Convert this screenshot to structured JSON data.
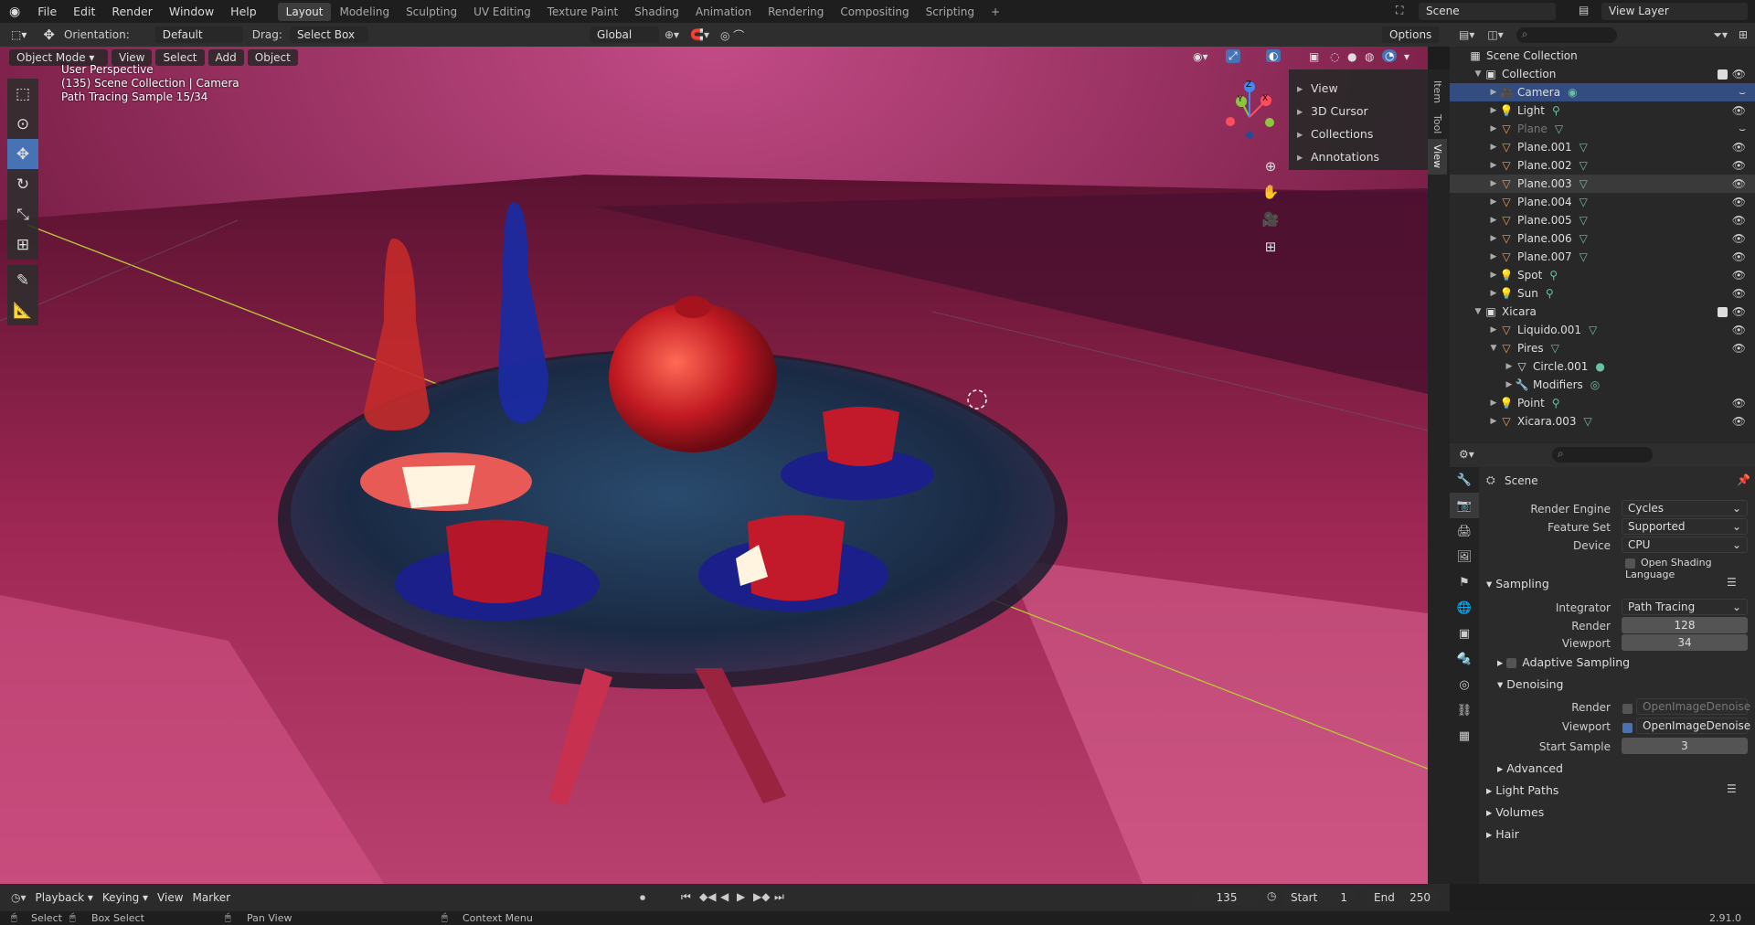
{
  "topbar": {
    "menus": [
      "File",
      "Edit",
      "Render",
      "Window",
      "Help"
    ],
    "workspaces": [
      "Layout",
      "Modeling",
      "Sculpting",
      "UV Editing",
      "Texture Paint",
      "Shading",
      "Animation",
      "Rendering",
      "Compositing",
      "Scripting"
    ],
    "active_workspace": "Layout",
    "add_tab": "+",
    "scene": "Scene",
    "view_layer": "View Layer"
  },
  "toolheader": {
    "orientation_label": "Orientation:",
    "orientation_value": "Default",
    "drag_label": "Drag:",
    "drag_value": "Select Box",
    "transform_value": "Global",
    "options": "Options"
  },
  "viewport": {
    "mode": "Object Mode",
    "menus": [
      "View",
      "Select",
      "Add",
      "Object"
    ],
    "info": [
      "User Perspective",
      "(135) Scene Collection | Camera",
      "Path Tracing Sample 15/34"
    ],
    "npanel_items": [
      "View",
      "3D Cursor",
      "Collections",
      "Annotations"
    ],
    "npanel_tabs": [
      "Item",
      "Tool",
      "View"
    ],
    "gizmo": {
      "x": "X",
      "y": "Y",
      "z": "Z"
    }
  },
  "outliner": {
    "rows": [
      {
        "label": "Scene Collection",
        "level": 0,
        "type": "scene"
      },
      {
        "label": "Collection",
        "level": 1,
        "type": "collection",
        "expanded": true
      },
      {
        "label": "Camera",
        "level": 2,
        "type": "camera",
        "selected": true
      },
      {
        "label": "Light",
        "level": 2,
        "type": "light"
      },
      {
        "label": "Plane",
        "level": 2,
        "type": "mesh",
        "dim": true
      },
      {
        "label": "Plane.001",
        "level": 2,
        "type": "mesh"
      },
      {
        "label": "Plane.002",
        "level": 2,
        "type": "mesh"
      },
      {
        "label": "Plane.003",
        "level": 2,
        "type": "mesh",
        "highlight": true
      },
      {
        "label": "Plane.004",
        "level": 2,
        "type": "mesh"
      },
      {
        "label": "Plane.005",
        "level": 2,
        "type": "mesh"
      },
      {
        "label": "Plane.006",
        "level": 2,
        "type": "mesh"
      },
      {
        "label": "Plane.007",
        "level": 2,
        "type": "mesh"
      },
      {
        "label": "Spot",
        "level": 2,
        "type": "light"
      },
      {
        "label": "Sun",
        "level": 2,
        "type": "light"
      },
      {
        "label": "Xicara",
        "level": 1,
        "type": "collection",
        "expanded": true
      },
      {
        "label": "Liquido.001",
        "level": 2,
        "type": "mesh"
      },
      {
        "label": "Pires",
        "level": 2,
        "type": "mesh",
        "expanded": true
      },
      {
        "label": "Circle.001",
        "level": 3,
        "type": "meshdata"
      },
      {
        "label": "Modifiers",
        "level": 3,
        "type": "modifiers"
      },
      {
        "label": "Point",
        "level": 2,
        "type": "light"
      },
      {
        "label": "Xicara.003",
        "level": 2,
        "type": "mesh"
      }
    ]
  },
  "properties": {
    "context": "Scene",
    "render_engine_label": "Render Engine",
    "render_engine": "Cycles",
    "feature_set_label": "Feature Set",
    "feature_set": "Supported",
    "device_label": "Device",
    "device": "CPU",
    "osl": "Open Shading Language",
    "sampling": "Sampling",
    "integrator_label": "Integrator",
    "integrator": "Path Tracing",
    "render_label": "Render",
    "render_samples": "128",
    "viewport_label": "Viewport",
    "viewport_samples": "34",
    "adaptive": "Adaptive Sampling",
    "denoising": "Denoising",
    "den_render_label": "Render",
    "den_render": "OpenImageDenoise",
    "den_viewport_label": "Viewport",
    "den_viewport": "OpenImageDenoise",
    "start_sample_label": "Start Sample",
    "start_sample": "3",
    "advanced": "Advanced",
    "light_paths": "Light Paths",
    "volumes": "Volumes",
    "hair": "Hair"
  },
  "timeline": {
    "menus": [
      "Playback",
      "Keying",
      "View",
      "Marker"
    ],
    "current_frame": "135",
    "start_label": "Start",
    "start": "1",
    "end_label": "End",
    "end": "250"
  },
  "statusbar": {
    "select": "Select",
    "box_select": "Box Select",
    "pan_view": "Pan View",
    "context_menu": "Context Menu",
    "version": "2.91.0"
  },
  "colors": {
    "accent": "#4772b3",
    "selection": "#334d80",
    "collection": "#e8a348"
  }
}
